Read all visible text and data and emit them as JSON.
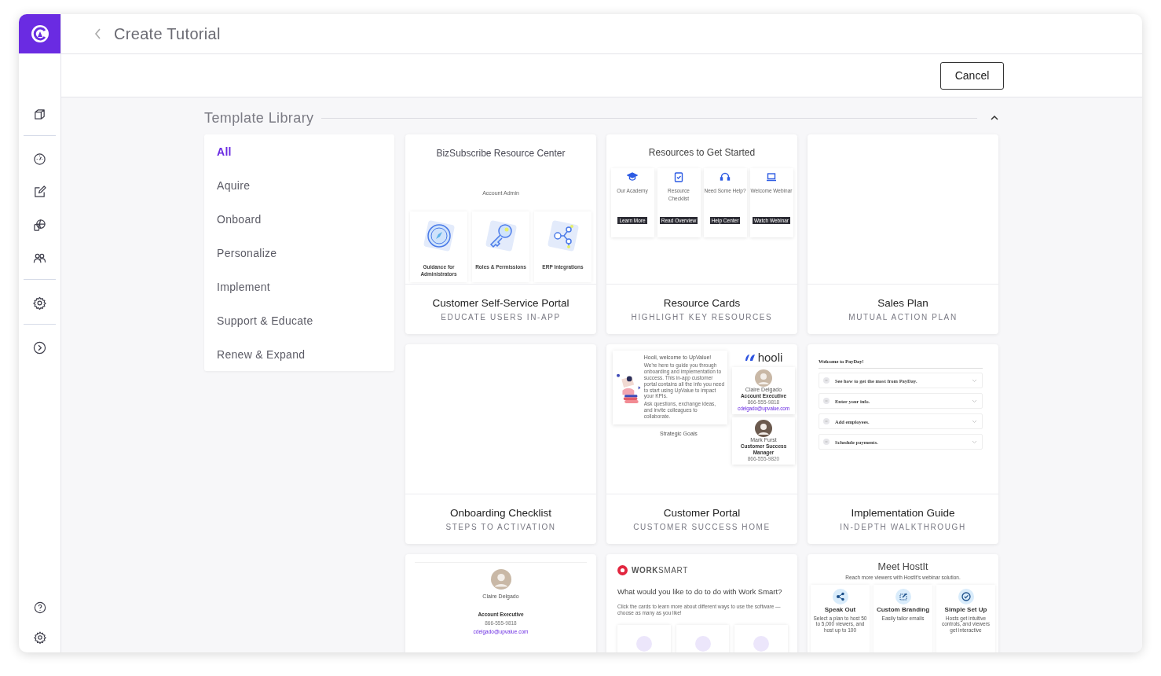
{
  "header": {
    "title": "Create Tutorial"
  },
  "toolbar": {
    "cancel_label": "Cancel"
  },
  "sidebar": {
    "groups": [
      {
        "items": [
          {
            "kind": "cube"
          }
        ]
      },
      {
        "items": [
          {
            "kind": "gauge"
          },
          {
            "kind": "edit"
          },
          {
            "kind": "globe"
          },
          {
            "kind": "people"
          }
        ]
      },
      {
        "items": [
          {
            "kind": "settings"
          }
        ]
      },
      {
        "items": [
          {
            "kind": "expand"
          }
        ]
      }
    ],
    "footer": [
      {
        "kind": "help"
      },
      {
        "kind": "settings"
      }
    ]
  },
  "library": {
    "title": "Template Library",
    "expanded": true
  },
  "filters": [
    {
      "label": "All",
      "selected": true
    },
    {
      "label": "Aquire",
      "selected": false
    },
    {
      "label": "Onboard",
      "selected": false
    },
    {
      "label": "Personalize",
      "selected": false
    },
    {
      "label": "Implement",
      "selected": false
    },
    {
      "label": "Support & Educate",
      "selected": false
    },
    {
      "label": "Renew & Expand",
      "selected": false
    }
  ],
  "templates": [
    {
      "title": "Customer Self-Service Portal",
      "subtitle": "EDUCATE USERS IN-APP",
      "preview": {
        "kind": "resource-center",
        "heading": "BizSubscribe Resource Center",
        "section": "Account Admin",
        "tiles": [
          {
            "kind": "compass",
            "label": "Guidance for Administrators"
          },
          {
            "kind": "key",
            "label": "Roles & Permissions"
          },
          {
            "kind": "network",
            "label": "ERP Integrations"
          }
        ]
      }
    },
    {
      "title": "Resource Cards",
      "subtitle": "HIGHLIGHT KEY RESOURCES",
      "preview": {
        "kind": "resource-cards",
        "heading": "Resources to Get Started",
        "tiles": [
          {
            "kind": "graduation",
            "label": "Our Academy",
            "button": "Learn More"
          },
          {
            "kind": "checklist",
            "label": "Resource Checklist",
            "button": "Read Overview"
          },
          {
            "kind": "headset",
            "label": "Need Some Help?",
            "button": "Help Center"
          },
          {
            "kind": "laptop",
            "label": "Welcome Webinar",
            "button": "Watch Webinar"
          }
        ]
      }
    },
    {
      "title": "Sales Plan",
      "subtitle": "MUTUAL ACTION PLAN"
    },
    {
      "title": "Onboarding Checklist",
      "subtitle": "STEPS TO ACTIVATION"
    },
    {
      "title": "Customer Portal",
      "subtitle": "CUSTOMER SUCCESS HOME",
      "preview": {
        "kind": "hooli-portal",
        "greeting": "Hooli, welcome to UpValue!",
        "intro": "We're here to guide you through onboarding and implementation to success. This in-app customer portal contains all the info you need to start using UpValue to impact your KPIs.",
        "invite": "Ask questions, exchange ideas, and invite colleagues to collaborate.",
        "section": "Strategic Goals",
        "brand": "hooli",
        "contacts": [
          {
            "name": "Claire Delgado",
            "role": "Account Executive",
            "phone": "866-555-9818",
            "email": "cdelgado@upvalue.com"
          },
          {
            "name": "Mark Furst",
            "role": "Customer Success Manager",
            "phone": "866-555-9820"
          }
        ]
      }
    },
    {
      "title": "Implementation Guide",
      "subtitle": "IN-DEPTH WALKTHROUGH",
      "preview": {
        "kind": "payday-guide",
        "heading": "Welcome to PayDay!",
        "steps": [
          "See how to get the most from PayDay.",
          "Enter your info.",
          "Add employees.",
          "Schedule payments."
        ]
      }
    },
    {
      "preview": {
        "kind": "contact",
        "name": "Claire Delgado",
        "role": "Account Executive",
        "phone": "866-555-9818",
        "email": "cdelgado@upvalue.com"
      }
    },
    {
      "preview": {
        "kind": "worksmart",
        "brand": "**WORK**SMART",
        "question": "What would you like to do to do with Work Smart?",
        "hint": "Click the cards to learn more about different ways to use the software — choose as many as you like!"
      }
    },
    {
      "preview": {
        "kind": "hostit",
        "heading": "Meet HostIt",
        "subheading": "Reach more viewers with HostIt's webinar solution.",
        "features": [
          {
            "kind": "share",
            "title": "Speak Out",
            "text": "Select a plan to host 50 to 5,000 viewers, and host up to 100"
          },
          {
            "kind": "brush",
            "title": "Custom Branding",
            "text": "Easily tailor emails"
          },
          {
            "kind": "check",
            "title": "Simple Set Up",
            "text": "Hosts get intuitive controls, and viewers get interactive"
          }
        ]
      }
    }
  ]
}
